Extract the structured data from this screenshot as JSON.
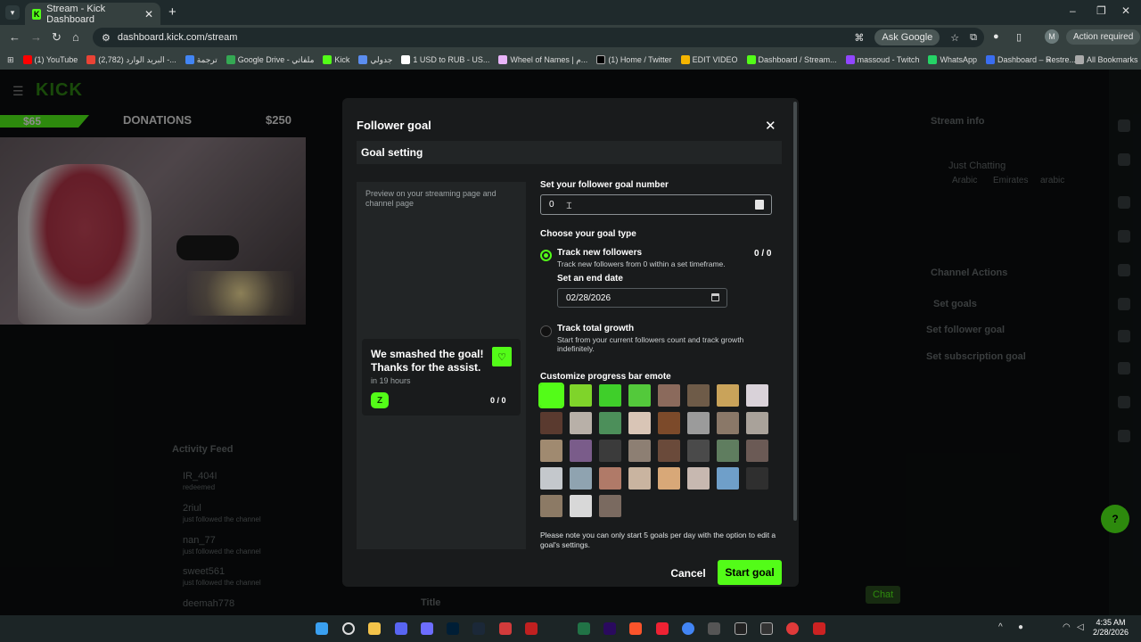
{
  "browser": {
    "tab_title": "Stream - Kick Dashboard",
    "url": "dashboard.kick.com/stream",
    "ask_google": "Ask Google",
    "action_required": "Action required",
    "bookmarks": [
      "(1) YouTube",
      "(2,782) البريد الوارد -...",
      "ترجمة",
      "Google Drive - ملفاتي",
      "Kick",
      "جدولي",
      "1 USD to RUB - US...",
      "Wheel of Names | م...",
      "(1) Home / Twitter",
      "EDIT VIDEO",
      "Dashboard / Stream...",
      "massoud - Twitch",
      "WhatsApp",
      "Dashboard – Restre..."
    ],
    "all_bookmarks": "All Bookmarks"
  },
  "background": {
    "logo": "KICK",
    "donation_amount": "$65",
    "donation_label": "DONATIONS",
    "donation_goal": "$250",
    "stream_info": "Stream info",
    "category": "Just Chatting",
    "tags": [
      "Arabic",
      "Emirates",
      "arabic"
    ],
    "channel_actions": "Channel Actions",
    "set_goals": "Set goals",
    "set_follower_goal": "Set follower goal",
    "set_subscription_goal": "Set subscription goal",
    "activity_feed": "Activity Feed",
    "activity": [
      {
        "user": "IR_404I",
        "text": "redeemed"
      },
      {
        "user": "2riul",
        "text": "just followed the channel"
      },
      {
        "user": "nan_77",
        "text": "just followed the channel"
      },
      {
        "user": "sweet561",
        "text": "just followed the channel"
      },
      {
        "user": "deemah778",
        "text": ""
      }
    ],
    "chat_button": "Chat",
    "title_label": "Title"
  },
  "modal": {
    "title": "Follower goal",
    "section": "Goal setting",
    "preview_desc": "Preview on your streaming page and channel page",
    "card_title": "We smashed the goal! Thanks for the assist.",
    "card_time": "in 19 hours",
    "card_count": "0 / 0",
    "goal_number_label": "Set your follower goal number",
    "goal_number_value": "0",
    "goal_type_label": "Choose your goal type",
    "option1_title": "Track new followers",
    "option1_desc": "Track new followers from 0 within a set timeframe.",
    "option1_count": "0 / 0",
    "end_date_label": "Set an end date",
    "end_date_value": "02/28/2026",
    "option2_title": "Track total growth",
    "option2_desc": "Start from your current followers count and track growth indefinitely.",
    "emote_label": "Customize progress bar emote",
    "note": "Please note you can only start 5 goals per day with the option to edit a goal's settings.",
    "cancel": "Cancel",
    "start": "Start goal",
    "selected_option": "track_new_followers",
    "emote_colors": [
      "#53fc18",
      "#7fd42a",
      "#3fcf2a",
      "#53c93b",
      "#8b6a5c",
      "#6e5b48",
      "#c9a35a",
      "#d9d2d9",
      "#5a3a2f",
      "#b8b0a8",
      "#4c8f5a",
      "#d9c5b6",
      "#7c4a2a",
      "#9b9b9b",
      "#8a7868",
      "#a9a29a",
      "#a08a70",
      "#7a5c8a",
      "#3b3b3b",
      "#8d7f73",
      "#6a4a3a",
      "#4a4a4a",
      "#5f7d5f",
      "#6b5a55",
      "#c4c8cc",
      "#8fa3b0",
      "#b07a68",
      "#c9b4a0",
      "#d8a878",
      "#c7b8b0",
      "#6f9fc9",
      "#2f2f2f",
      "#8c7a65",
      "#d8d8d8",
      "#7a6a60"
    ],
    "accent": "#53fc18"
  },
  "taskbar": {
    "time": "4:35 AM",
    "date": "2/28/2026"
  }
}
